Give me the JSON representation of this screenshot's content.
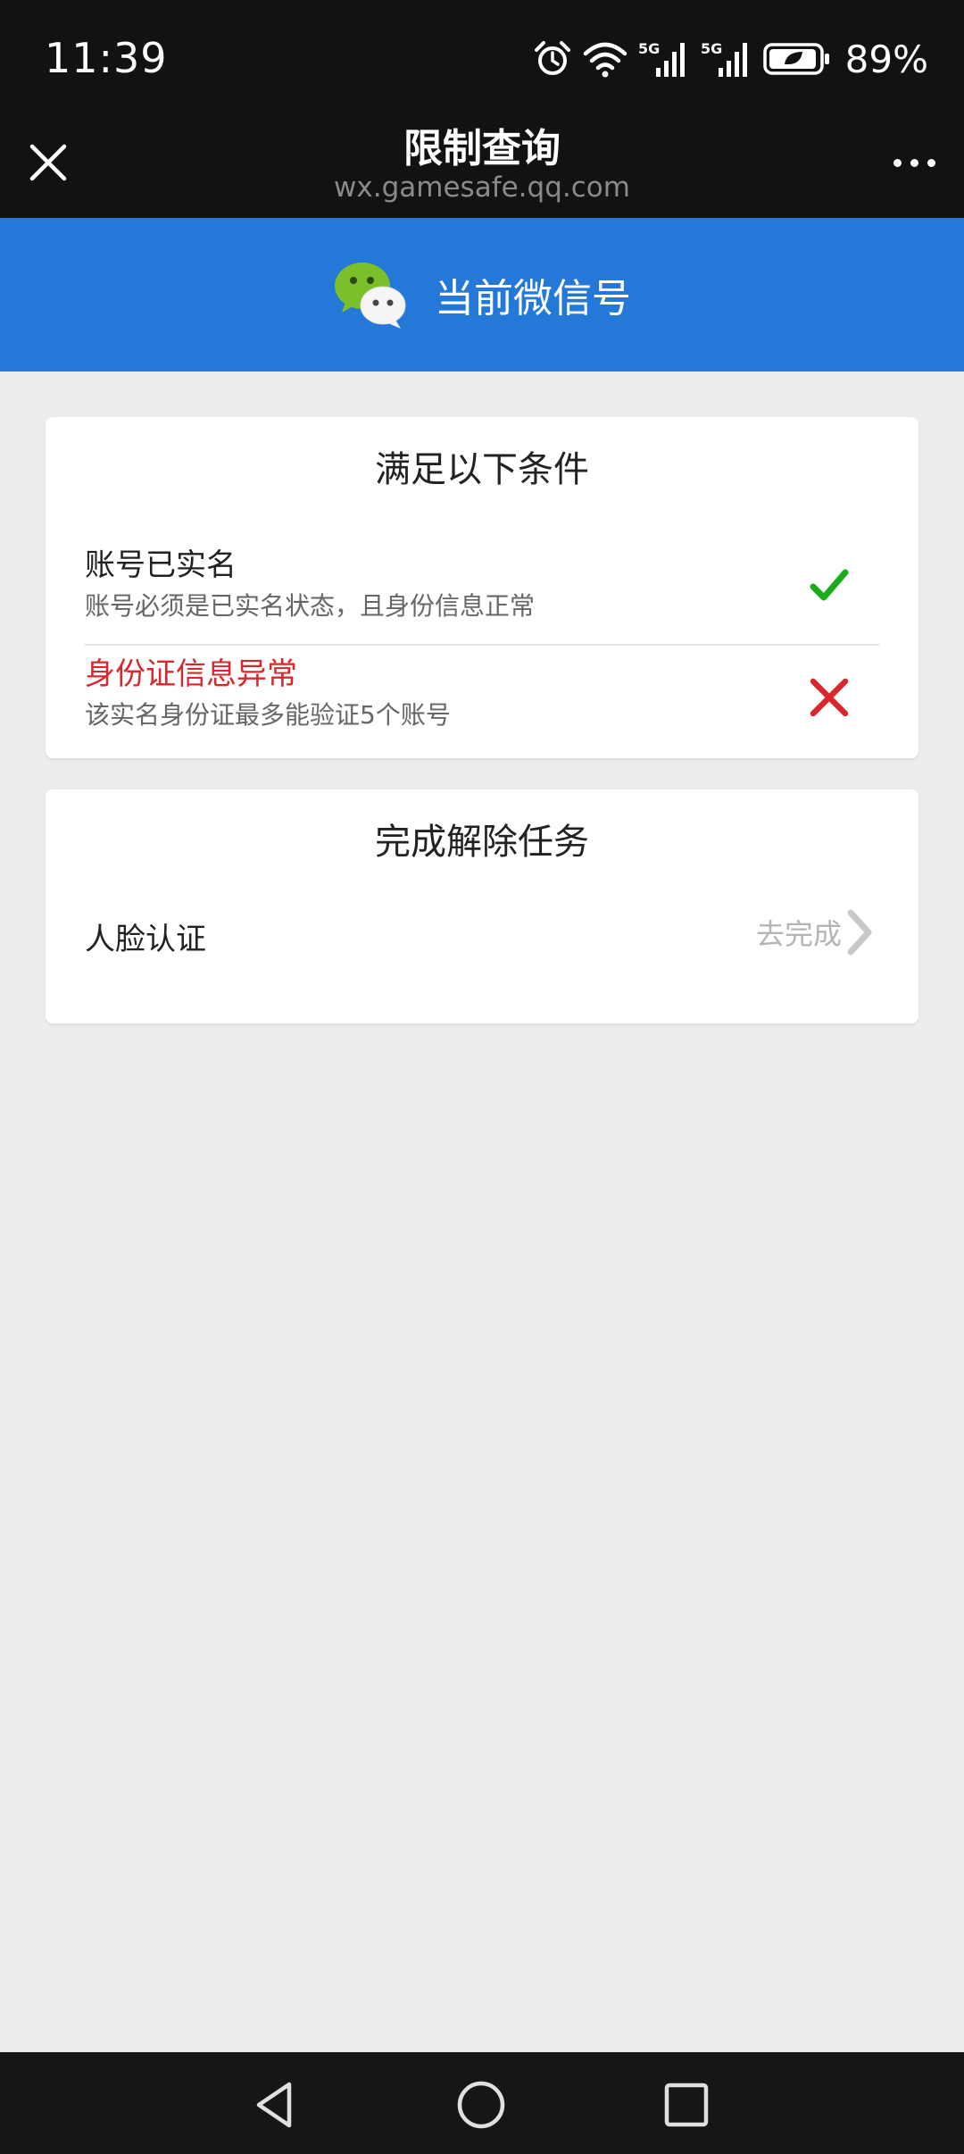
{
  "status_bar": {
    "time": "11:39",
    "battery": "89%",
    "icons": [
      "alarm-icon",
      "wifi-icon",
      "signal-5g-icon",
      "signal-5g-icon",
      "battery-icon"
    ]
  },
  "title_bar": {
    "title": "限制查询",
    "domain": "wx.gamesafe.qq.com"
  },
  "account_header": {
    "label": "当前微信号",
    "color": "#2378d8"
  },
  "conditions": {
    "title": "满足以下条件",
    "items": [
      {
        "title": "账号已实名",
        "desc": "账号必须是已实名状态，且身份信息正常",
        "status": "pass",
        "color": "#1aad19"
      },
      {
        "title": "身份证信息异常",
        "desc": "该实名身份证最多能验证5个账号",
        "status": "fail",
        "color": "#d9272e"
      }
    ]
  },
  "tasks": {
    "title": "完成解除任务",
    "items": [
      {
        "label": "人脸认证",
        "action": "去完成"
      }
    ]
  }
}
